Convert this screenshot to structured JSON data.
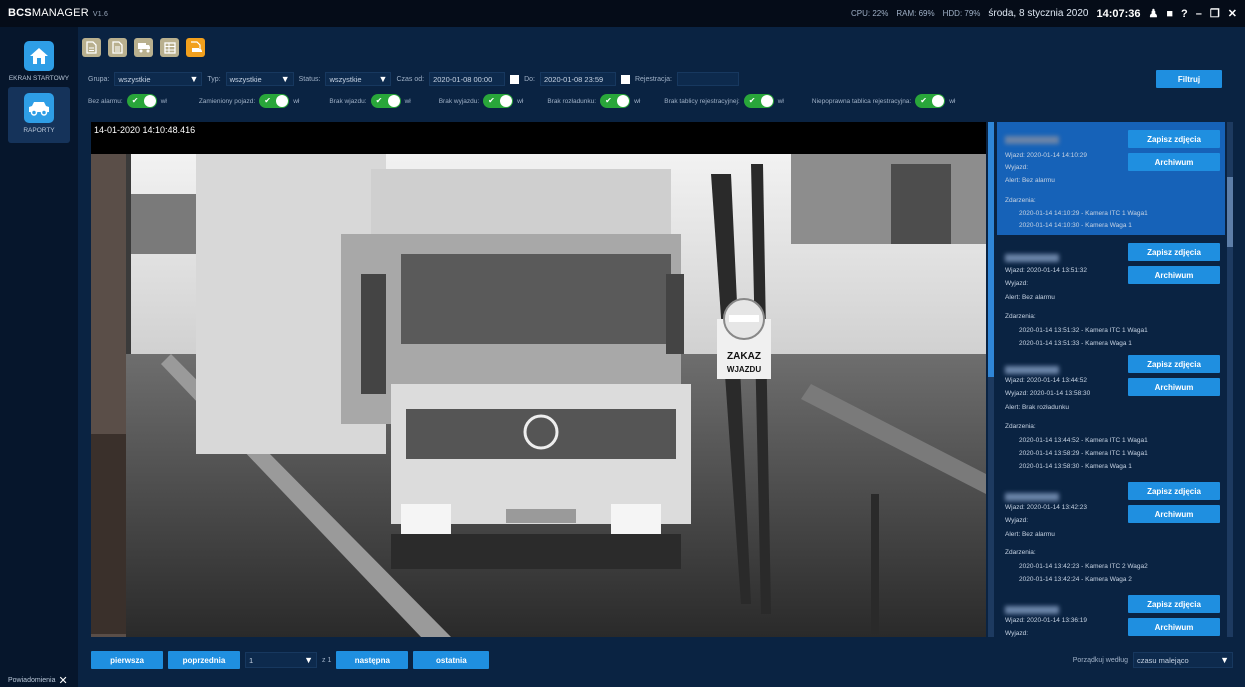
{
  "app": {
    "brand_bold": "BCS",
    "brand_rest": "MANAGER",
    "version": "V1.6"
  },
  "system": {
    "cpu": "CPU: 22%",
    "ram": "RAM: 69%",
    "hdd": "HDD: 79%",
    "date": "środa, 8 stycznia 2020",
    "time": "14:07:36"
  },
  "sidebar": {
    "items": [
      {
        "label": "EKRAN STARTOWY",
        "icon": "home-icon"
      },
      {
        "label": "RAPORTY",
        "icon": "car-icon"
      }
    ]
  },
  "notifications_label": "Powiadomienia",
  "filters": {
    "grupa_label": "Grupa:",
    "grupa_value": "wszystkie",
    "typ_label": "Typ:",
    "typ_value": "wszystkie",
    "status_label": "Status:",
    "status_value": "wszystkie",
    "czas_od_label": "Czas od:",
    "czas_od_value": "2020-01-08 00:00",
    "do_label": "Do:",
    "do_value": "2020-01-08 23:59",
    "rejestracja_label": "Rejestracja:",
    "rejestracja_value": "",
    "filter_button": "Filtruj"
  },
  "toggles": [
    {
      "label": "Bez alarmu:",
      "state": "wł"
    },
    {
      "label": "Zamieniony pojazd:",
      "state": "wł"
    },
    {
      "label": "Brak wjazdu:",
      "state": "wł"
    },
    {
      "label": "Brak wyjazdu:",
      "state": "wł"
    },
    {
      "label": "Brak rozładunku:",
      "state": "wł"
    },
    {
      "label": "Brak tablicy rejestracyjnej:",
      "state": "wł"
    },
    {
      "label": "Niepoprawna tablica rejestracyjna:",
      "state": "wł"
    }
  ],
  "viewer": {
    "timestamp": "14-01-2020 14:10:48.416",
    "sign_line1": "ZAKAZ",
    "sign_line2": "WJAZDU"
  },
  "passages": [
    {
      "wjazd": "Wjazd:  2020-01-14 14:10:29",
      "wyjazd": "Wyjazd:",
      "alert": "Alert:   Bez alarmu",
      "events_label": "Zdarzenia:",
      "events": [
        "2020-01-14 14:10:29 - Kamera ITC 1 Waga1",
        "2020-01-14 14:10:30 - Kamera Waga 1"
      ],
      "selected": true
    },
    {
      "wjazd": "Wjazd:  2020-01-14 13:51:32",
      "wyjazd": "Wyjazd:",
      "alert": "Alert:   Bez alarmu",
      "events_label": "Zdarzenia:",
      "events": [
        "2020-01-14 13:51:32 - Kamera ITC 1 Waga1",
        "2020-01-14 13:51:33 - Kamera Waga 1"
      ],
      "selected": false
    },
    {
      "wjazd": "Wjazd:  2020-01-14 13:44:52",
      "wyjazd": "Wyjazd: 2020-01-14 13:58:30",
      "alert": "Alert:   Brak rozładunku",
      "events_label": "Zdarzenia:",
      "events": [
        "2020-01-14 13:44:52 - Kamera ITC 1 Waga1",
        "2020-01-14 13:58:29 - Kamera ITC 1 Waga1",
        "2020-01-14 13:58:30 - Kamera Waga 1"
      ],
      "selected": false
    },
    {
      "wjazd": "Wjazd:  2020-01-14 13:42:23",
      "wyjazd": "Wyjazd:",
      "alert": "Alert:   Bez alarmu",
      "events_label": "Zdarzenia:",
      "events": [
        "2020-01-14 13:42:23 - Kamera ITC 2 Waga2",
        "2020-01-14 13:42:24 - Kamera Waga 2"
      ],
      "selected": false
    },
    {
      "wjazd": "Wjazd:  2020-01-14 13:36:19",
      "wyjazd": "Wyjazd:",
      "alert": "",
      "events_label": "",
      "events": [],
      "selected": false
    }
  ],
  "card_buttons": {
    "photos": "Zapisz zdjęcia",
    "archive": "Archiwum"
  },
  "pager": {
    "first": "pierwsza",
    "prev": "poprzednia",
    "page": "1",
    "of": "z 1",
    "next": "następna",
    "last": "ostatnia"
  },
  "sort": {
    "label": "Porządkuj według",
    "value": "czasu malejąco"
  },
  "colors": {
    "background": "#0a2342",
    "accent": "#1f8fe0",
    "toggle_on": "#29a63a",
    "toolbar_active": "#f2a01d",
    "selected_card": "#1662b8"
  }
}
